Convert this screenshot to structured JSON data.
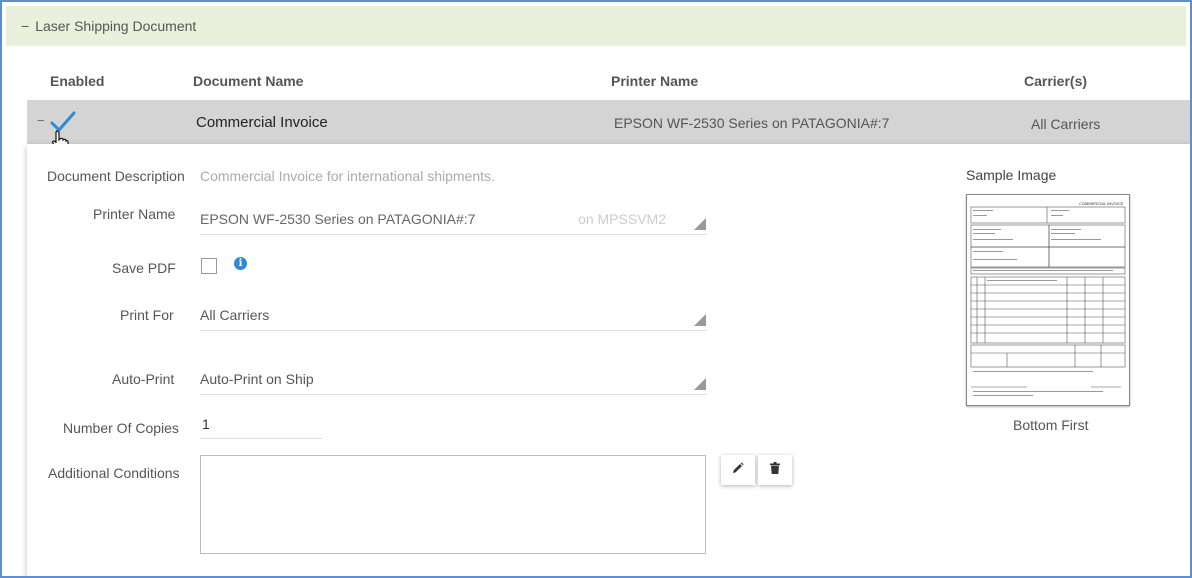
{
  "section": {
    "toggle": "−",
    "title": "Laser Shipping Document"
  },
  "columns": {
    "enabled": "Enabled",
    "document_name": "Document Name",
    "printer_name": "Printer Name",
    "carriers": "Carrier(s)"
  },
  "row": {
    "toggle": "−",
    "enabled": true,
    "document_name": "Commercial Invoice",
    "printer_name": "EPSON WF-2530 Series on PATAGONIA#:7",
    "carriers": "All Carriers"
  },
  "details": {
    "description_label": "Document Description",
    "description_value": "Commercial Invoice for international shipments.",
    "printer_label": "Printer Name",
    "printer_value": "EPSON WF-2530 Series on PATAGONIA#:7",
    "printer_suffix": "on MPSSVM2",
    "save_pdf_label": "Save PDF",
    "save_pdf_checked": false,
    "print_for_label": "Print For",
    "print_for_value": "All Carriers",
    "auto_print_label": "Auto-Print",
    "auto_print_value": "Auto-Print on Ship",
    "copies_label": "Number Of Copies",
    "copies_value": "1",
    "conditions_label": "Additional Conditions",
    "conditions_value": "",
    "edit_icon": "pencil-icon",
    "delete_icon": "trash-icon",
    "sample_label": "Sample Image",
    "sample_caption": "Bottom First",
    "sample_doc_title": "COMMERCIAL INVOICE"
  },
  "colors": {
    "header_bg": "#e9f1dd",
    "row_bg": "#d4d4d4",
    "accent": "#2d8ad6",
    "frame_border": "#5b8fd6"
  }
}
